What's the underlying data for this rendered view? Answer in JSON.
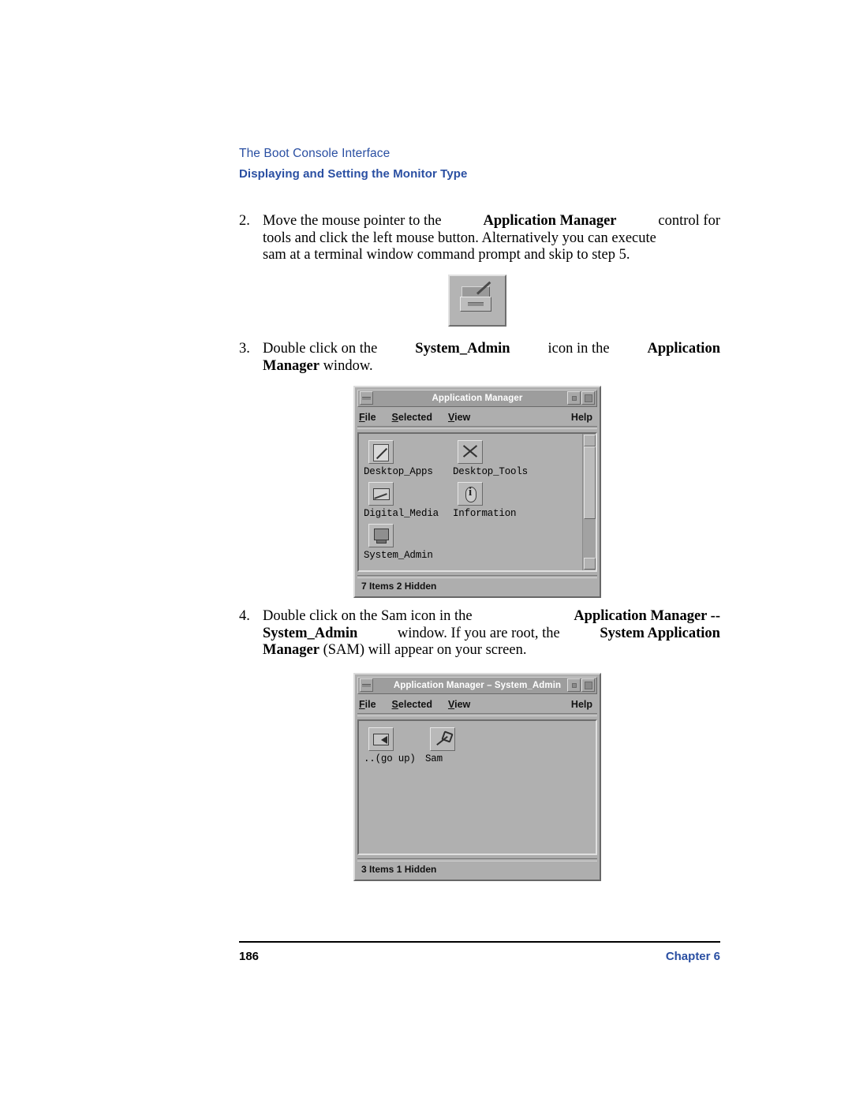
{
  "header": {
    "running_head": "The Boot Console Interface",
    "section_title": "Displaying and Setting the Monitor Type"
  },
  "steps": {
    "step2": {
      "number": "2.",
      "line1_a": "Move the mouse pointer to the ",
      "line1_b": "Application Manager",
      "line1_c": " control for",
      "line2": "tools and click the left mouse button. Alternatively you can execute",
      "line3": "sam at a terminal window command prompt and skip to step 5."
    },
    "step3": {
      "number": "3.",
      "line1_a": "Double click on the ",
      "line1_b": "System_Admin",
      "line1_c": " icon in the ",
      "line1_d": "Application",
      "line2_a": "Manager",
      "line2_b": " window."
    },
    "step4": {
      "number": "4.",
      "line1_a": "Double click on the Sam icon in the ",
      "line1_b": "Application Manager --",
      "line2_a": "System_Admin",
      "line2_b": " window. If you are root, the ",
      "line2_c": "System Application",
      "line3_a": "Manager",
      "line3_b": " (SAM) will appear on your screen."
    }
  },
  "appmgr_control_icon": {
    "name": "application-manager-control-icon"
  },
  "window1": {
    "title": "Application Manager",
    "menus": [
      {
        "underline": "F",
        "rest": "ile"
      },
      {
        "underline": "S",
        "rest": "elected"
      },
      {
        "underline": "V",
        "rest": "iew"
      }
    ],
    "help_underline": "H",
    "help_rest": "elp",
    "icons": [
      [
        {
          "label": "Desktop_Apps",
          "mark": "mk-pencil",
          "icon_name": "desktop-apps-icon"
        },
        {
          "label": "Desktop_Tools",
          "mark": "mk-x",
          "icon_name": "desktop-tools-icon"
        }
      ],
      [
        {
          "label": "Digital_Media",
          "mark": "mk-wave",
          "icon_name": "digital-media-icon"
        },
        {
          "label": "Information",
          "mark": "mk-info",
          "icon_name": "information-icon"
        }
      ],
      [
        {
          "label": "System_Admin",
          "mark": "mk-monitor",
          "icon_name": "system-admin-icon"
        }
      ]
    ],
    "status": "7 Items 2 Hidden"
  },
  "window2": {
    "title": "Application Manager – System_Admin",
    "menus": [
      {
        "underline": "F",
        "rest": "ile"
      },
      {
        "underline": "S",
        "rest": "elected"
      },
      {
        "underline": "V",
        "rest": "iew"
      }
    ],
    "help_underline": "H",
    "help_rest": "elp",
    "icons": [
      [
        {
          "label": "..(go up)",
          "mark": "mk-goup",
          "icon_name": "go-up-icon"
        },
        {
          "label": "Sam",
          "mark": "mk-sam",
          "icon_name": "sam-icon"
        }
      ]
    ],
    "status": "3 Items 1 Hidden"
  },
  "footer": {
    "page_number": "186",
    "chapter_label": "Chapter 6"
  },
  "colors": {
    "accent_blue": "#2a4fa2",
    "window_gray": "#aeaeae",
    "canvas_gray": "#b0b0b0"
  }
}
